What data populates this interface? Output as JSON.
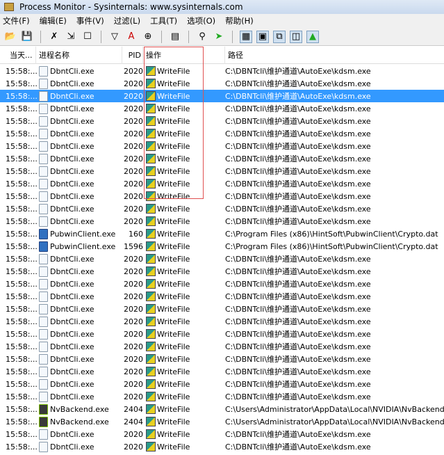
{
  "title": "Process Monitor - Sysinternals: www.sysinternals.com",
  "menu": [
    "文件(F)",
    "编辑(E)",
    "事件(V)",
    "过滤(L)",
    "工具(T)",
    "选项(O)",
    "帮助(H)"
  ],
  "toolbar": [
    "open-icon",
    "save-icon",
    "|",
    "capture-icon",
    "autoscroll-icon",
    "clear-icon",
    "|",
    "filter-icon",
    "highlight-icon",
    "target-icon",
    "|",
    "process-tree-icon",
    "|",
    "find-icon",
    "jump-icon",
    "|",
    "registry-activity-icon",
    "file-activity-icon",
    "network-activity-icon",
    "process-activity-icon",
    "profiling-icon"
  ],
  "columns": {
    "time": "当天...",
    "process": "进程名称",
    "pid": "PID",
    "operation": "操作",
    "path": "路径"
  },
  "selected_index": 2,
  "rows": [
    {
      "time": "15:58:...",
      "process": "DbntCli.exe",
      "pid": "2020",
      "op": "WriteFile",
      "path": "C:\\DBNTcli\\维护通道\\AutoExe\\kdsm.exe",
      "icon": "file"
    },
    {
      "time": "15:58:...",
      "process": "DbntCli.exe",
      "pid": "2020",
      "op": "WriteFile",
      "path": "C:\\DBNTcli\\维护通道\\AutoExe\\kdsm.exe",
      "icon": "file"
    },
    {
      "time": "15:58:...",
      "process": "DbntCli.exe",
      "pid": "2020",
      "op": "WriteFile",
      "path": "C:\\DBNTcli\\维护通道\\AutoExe\\kdsm.exe",
      "icon": "file"
    },
    {
      "time": "15:58:...",
      "process": "DbntCli.exe",
      "pid": "2020",
      "op": "WriteFile",
      "path": "C:\\DBNTcli\\维护通道\\AutoExe\\kdsm.exe",
      "icon": "file"
    },
    {
      "time": "15:58:...",
      "process": "DbntCli.exe",
      "pid": "2020",
      "op": "WriteFile",
      "path": "C:\\DBNTcli\\维护通道\\AutoExe\\kdsm.exe",
      "icon": "file"
    },
    {
      "time": "15:58:...",
      "process": "DbntCli.exe",
      "pid": "2020",
      "op": "WriteFile",
      "path": "C:\\DBNTcli\\维护通道\\AutoExe\\kdsm.exe",
      "icon": "file"
    },
    {
      "time": "15:58:...",
      "process": "DbntCli.exe",
      "pid": "2020",
      "op": "WriteFile",
      "path": "C:\\DBNTcli\\维护通道\\AutoExe\\kdsm.exe",
      "icon": "file"
    },
    {
      "time": "15:58:...",
      "process": "DbntCli.exe",
      "pid": "2020",
      "op": "WriteFile",
      "path": "C:\\DBNTcli\\维护通道\\AutoExe\\kdsm.exe",
      "icon": "file"
    },
    {
      "time": "15:58:...",
      "process": "DbntCli.exe",
      "pid": "2020",
      "op": "WriteFile",
      "path": "C:\\DBNTcli\\维护通道\\AutoExe\\kdsm.exe",
      "icon": "file"
    },
    {
      "time": "15:58:...",
      "process": "DbntCli.exe",
      "pid": "2020",
      "op": "WriteFile",
      "path": "C:\\DBNTcli\\维护通道\\AutoExe\\kdsm.exe",
      "icon": "file"
    },
    {
      "time": "15:58:...",
      "process": "DbntCli.exe",
      "pid": "2020",
      "op": "WriteFile",
      "path": "C:\\DBNTcli\\维护通道\\AutoExe\\kdsm.exe",
      "icon": "file"
    },
    {
      "time": "15:58:...",
      "process": "DbntCli.exe",
      "pid": "2020",
      "op": "WriteFile",
      "path": "C:\\DBNTcli\\维护通道\\AutoExe\\kdsm.exe",
      "icon": "file"
    },
    {
      "time": "15:58:...",
      "process": "DbntCli.exe",
      "pid": "2020",
      "op": "WriteFile",
      "path": "C:\\DBNTcli\\维护通道\\AutoExe\\kdsm.exe",
      "icon": "file"
    },
    {
      "time": "15:58:...",
      "process": "PubwinClient.exe",
      "pid": "160",
      "op": "WriteFile",
      "path": "C:\\Program Files (x86)\\HintSoft\\PubwinClient\\Crypto.dat",
      "icon": "pub"
    },
    {
      "time": "15:58:...",
      "process": "PubwinClient.exe",
      "pid": "1596",
      "op": "WriteFile",
      "path": "C:\\Program Files (x86)\\HintSoft\\PubwinClient\\Crypto.dat",
      "icon": "pub"
    },
    {
      "time": "15:58:...",
      "process": "DbntCli.exe",
      "pid": "2020",
      "op": "WriteFile",
      "path": "C:\\DBNTcli\\维护通道\\AutoExe\\kdsm.exe",
      "icon": "file"
    },
    {
      "time": "15:58:...",
      "process": "DbntCli.exe",
      "pid": "2020",
      "op": "WriteFile",
      "path": "C:\\DBNTcli\\维护通道\\AutoExe\\kdsm.exe",
      "icon": "file"
    },
    {
      "time": "15:58:...",
      "process": "DbntCli.exe",
      "pid": "2020",
      "op": "WriteFile",
      "path": "C:\\DBNTcli\\维护通道\\AutoExe\\kdsm.exe",
      "icon": "file"
    },
    {
      "time": "15:58:...",
      "process": "DbntCli.exe",
      "pid": "2020",
      "op": "WriteFile",
      "path": "C:\\DBNTcli\\维护通道\\AutoExe\\kdsm.exe",
      "icon": "file"
    },
    {
      "time": "15:58:...",
      "process": "DbntCli.exe",
      "pid": "2020",
      "op": "WriteFile",
      "path": "C:\\DBNTcli\\维护通道\\AutoExe\\kdsm.exe",
      "icon": "file"
    },
    {
      "time": "15:58:...",
      "process": "DbntCli.exe",
      "pid": "2020",
      "op": "WriteFile",
      "path": "C:\\DBNTcli\\维护通道\\AutoExe\\kdsm.exe",
      "icon": "file"
    },
    {
      "time": "15:58:...",
      "process": "DbntCli.exe",
      "pid": "2020",
      "op": "WriteFile",
      "path": "C:\\DBNTcli\\维护通道\\AutoExe\\kdsm.exe",
      "icon": "file"
    },
    {
      "time": "15:58:...",
      "process": "DbntCli.exe",
      "pid": "2020",
      "op": "WriteFile",
      "path": "C:\\DBNTcli\\维护通道\\AutoExe\\kdsm.exe",
      "icon": "file"
    },
    {
      "time": "15:58:...",
      "process": "DbntCli.exe",
      "pid": "2020",
      "op": "WriteFile",
      "path": "C:\\DBNTcli\\维护通道\\AutoExe\\kdsm.exe",
      "icon": "file"
    },
    {
      "time": "15:58:...",
      "process": "DbntCli.exe",
      "pid": "2020",
      "op": "WriteFile",
      "path": "C:\\DBNTcli\\维护通道\\AutoExe\\kdsm.exe",
      "icon": "file"
    },
    {
      "time": "15:58:...",
      "process": "DbntCli.exe",
      "pid": "2020",
      "op": "WriteFile",
      "path": "C:\\DBNTcli\\维护通道\\AutoExe\\kdsm.exe",
      "icon": "file"
    },
    {
      "time": "15:58:...",
      "process": "DbntCli.exe",
      "pid": "2020",
      "op": "WriteFile",
      "path": "C:\\DBNTcli\\维护通道\\AutoExe\\kdsm.exe",
      "icon": "file"
    },
    {
      "time": "15:58:...",
      "process": "NvBackend.exe",
      "pid": "2404",
      "op": "WriteFile",
      "path": "C:\\Users\\Administrator\\AppData\\Local\\NVIDIA\\NvBackend\\",
      "icon": "nv"
    },
    {
      "time": "15:58:...",
      "process": "NvBackend.exe",
      "pid": "2404",
      "op": "WriteFile",
      "path": "C:\\Users\\Administrator\\AppData\\Local\\NVIDIA\\NvBackend\\",
      "icon": "nv"
    },
    {
      "time": "15:58:...",
      "process": "DbntCli.exe",
      "pid": "2020",
      "op": "WriteFile",
      "path": "C:\\DBNTcli\\维护通道\\AutoExe\\kdsm.exe",
      "icon": "file"
    },
    {
      "time": "15:58:...",
      "process": "DbntCli.exe",
      "pid": "2020",
      "op": "WriteFile",
      "path": "C:\\DBNTcli\\维护通道\\AutoExe\\kdsm.exe",
      "icon": "file"
    }
  ]
}
